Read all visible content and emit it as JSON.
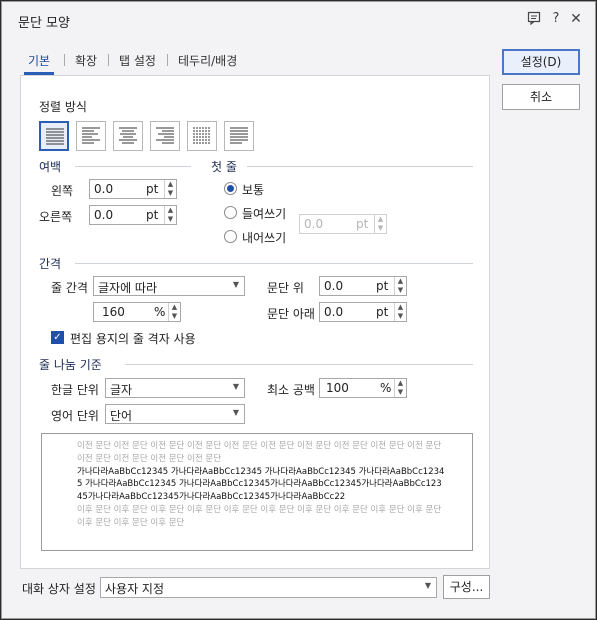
{
  "title": "문단 모양",
  "titlebar_icons": [
    "chat-icon",
    "help-icon",
    "close-icon"
  ],
  "tabs": [
    "기본",
    "확장",
    "탭 설정",
    "테두리/배경"
  ],
  "buttons": {
    "ok": "설정(D)",
    "cancel": "취소",
    "compose": "구성..."
  },
  "alignment": {
    "label": "정렬 방식",
    "options": [
      "justify-align-icon",
      "left-align-icon",
      "center-align-icon",
      "right-align-icon",
      "distribute-align-icon",
      "divide-align-icon"
    ],
    "selected_index": 0
  },
  "margin": {
    "label": "여백",
    "left_label": "왼쪽",
    "left_value": "0.0",
    "right_label": "오른쪽",
    "right_value": "0.0",
    "unit": "pt"
  },
  "first_line": {
    "label": "첫 줄",
    "options": [
      "보통",
      "들여쓰기",
      "내어쓰기"
    ],
    "selected": "보통",
    "value": "0.0",
    "unit": "pt"
  },
  "spacing": {
    "label": "간격",
    "line_spacing_label": "줄 간격",
    "line_spacing_type": "글자에 따라",
    "line_spacing_value": "160",
    "line_spacing_unit": "%",
    "above_label": "문단 위",
    "above_value": "0.0",
    "below_label": "문단 아래",
    "below_value": "0.0",
    "unit": "pt",
    "grid_checkbox_label": "편집 용지의 줄 격자 사용",
    "grid_checked": true
  },
  "line_break": {
    "label": "줄 나눔 기준",
    "korean_label": "한글 단위",
    "korean_value": "글자",
    "english_label": "영어 단위",
    "english_value": "단어",
    "min_space_label": "최소 공백",
    "min_space_value": "100",
    "min_space_unit": "%"
  },
  "preview": {
    "before": "이전 문단 이전 문단 이전 문단 이전 문단 이전 문단 이전 문단 이전 문단 이전 문단 이전 문단 이전 문단 이전 문단 이전 문단 이전 문단 이전 문단",
    "current": "가나다라AaBbCc12345 가나다라AaBbCc12345 가나다라AaBbCc12345 가나다라AaBbCc12345 가나다라AaBbCc12345 가나다라AaBbCc12345가나다라AaBbCc12345가나다라AaBbCc12345가나다라AaBbCc12345가나다라AaBbCc12345가나다라AaBbCc22",
    "after": "이후 문단 이후 문단 이후 문단 이후 문단 이후 문단 이후 문단 이후 문단 이후 문단 이후 문단 이후 문단 이후 문단 이후 문단 이후 문단"
  },
  "dialog_setting": {
    "label": "대화 상자 설정",
    "value": "사용자 지정"
  }
}
